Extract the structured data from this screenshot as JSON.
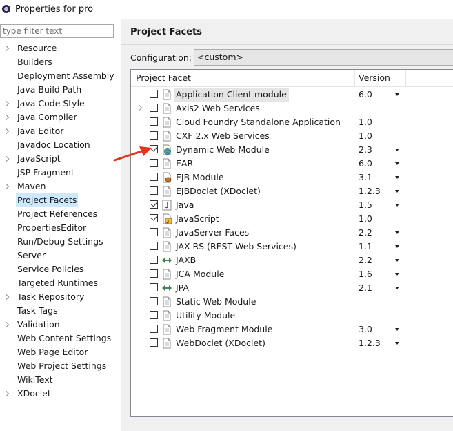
{
  "window": {
    "title": "Properties for pro"
  },
  "filter": {
    "placeholder": "type filter text",
    "value": ""
  },
  "nav": {
    "items": [
      {
        "label": "Resource",
        "expandable": true
      },
      {
        "label": "Builders",
        "expandable": false
      },
      {
        "label": "Deployment Assembly",
        "expandable": false
      },
      {
        "label": "Java Build Path",
        "expandable": false
      },
      {
        "label": "Java Code Style",
        "expandable": true
      },
      {
        "label": "Java Compiler",
        "expandable": true
      },
      {
        "label": "Java Editor",
        "expandable": true
      },
      {
        "label": "Javadoc Location",
        "expandable": false
      },
      {
        "label": "JavaScript",
        "expandable": true
      },
      {
        "label": "JSP Fragment",
        "expandable": false
      },
      {
        "label": "Maven",
        "expandable": true
      },
      {
        "label": "Project Facets",
        "expandable": false,
        "selected": true
      },
      {
        "label": "Project References",
        "expandable": false
      },
      {
        "label": "PropertiesEditor",
        "expandable": false
      },
      {
        "label": "Run/Debug Settings",
        "expandable": false
      },
      {
        "label": "Server",
        "expandable": false
      },
      {
        "label": "Service Policies",
        "expandable": false
      },
      {
        "label": "Targeted Runtimes",
        "expandable": false
      },
      {
        "label": "Task Repository",
        "expandable": true
      },
      {
        "label": "Task Tags",
        "expandable": false
      },
      {
        "label": "Validation",
        "expandable": true
      },
      {
        "label": "Web Content Settings",
        "expandable": false
      },
      {
        "label": "Web Page Editor",
        "expandable": false
      },
      {
        "label": "Web Project Settings",
        "expandable": false
      },
      {
        "label": "WikiText",
        "expandable": false
      },
      {
        "label": "XDoclet",
        "expandable": true
      }
    ]
  },
  "panel": {
    "title": "Project Facets",
    "configuration_label": "Configuration:",
    "configuration_value": "<custom>"
  },
  "table": {
    "headers": {
      "facet": "Project Facet",
      "version": "Version"
    },
    "rows": [
      {
        "name": "Application Client module",
        "version": "6.0",
        "checked": false,
        "dropdown": true,
        "icon": "page-icon",
        "highlight": true
      },
      {
        "name": "Axis2 Web Services",
        "version": "",
        "checked": false,
        "dropdown": false,
        "icon": "page-icon",
        "expandable": true
      },
      {
        "name": "Cloud Foundry Standalone Application",
        "version": "1.0",
        "checked": false,
        "dropdown": false,
        "icon": "page-icon"
      },
      {
        "name": "CXF 2.x Web Services",
        "version": "1.0",
        "checked": false,
        "dropdown": false,
        "icon": "page-icon"
      },
      {
        "name": "Dynamic Web Module",
        "version": "2.3",
        "checked": true,
        "dropdown": true,
        "icon": "globe-icon"
      },
      {
        "name": "EAR",
        "version": "6.0",
        "checked": false,
        "dropdown": true,
        "icon": "page-icon"
      },
      {
        "name": "EJB Module",
        "version": "3.1",
        "checked": false,
        "dropdown": true,
        "icon": "bean-icon"
      },
      {
        "name": "EJBDoclet (XDoclet)",
        "version": "1.2.3",
        "checked": false,
        "dropdown": true,
        "icon": "page-icon"
      },
      {
        "name": "Java",
        "version": "1.5",
        "checked": true,
        "dropdown": true,
        "icon": "java-icon"
      },
      {
        "name": "JavaScript",
        "version": "1.0",
        "checked": true,
        "dropdown": false,
        "icon": "javascript-icon"
      },
      {
        "name": "JavaServer Faces",
        "version": "2.2",
        "checked": false,
        "dropdown": true,
        "icon": "page-icon"
      },
      {
        "name": "JAX-RS (REST Web Services)",
        "version": "1.1",
        "checked": false,
        "dropdown": true,
        "icon": "page-icon"
      },
      {
        "name": "JAXB",
        "version": "2.2",
        "checked": false,
        "dropdown": true,
        "icon": "arrows-icon"
      },
      {
        "name": "JCA Module",
        "version": "1.6",
        "checked": false,
        "dropdown": true,
        "icon": "page-icon"
      },
      {
        "name": "JPA",
        "version": "2.1",
        "checked": false,
        "dropdown": true,
        "icon": "arrows-icon"
      },
      {
        "name": "Static Web Module",
        "version": "",
        "checked": false,
        "dropdown": false,
        "icon": "page-icon"
      },
      {
        "name": "Utility Module",
        "version": "",
        "checked": false,
        "dropdown": false,
        "icon": "page-icon"
      },
      {
        "name": "Web Fragment Module",
        "version": "3.0",
        "checked": false,
        "dropdown": true,
        "icon": "page-icon"
      },
      {
        "name": "WebDoclet (XDoclet)",
        "version": "1.2.3",
        "checked": false,
        "dropdown": true,
        "icon": "page-icon"
      }
    ]
  },
  "colors": {
    "selection": "#cde8ff",
    "annotation": "#e8321e",
    "panel_bg": "#f0f0f0"
  }
}
